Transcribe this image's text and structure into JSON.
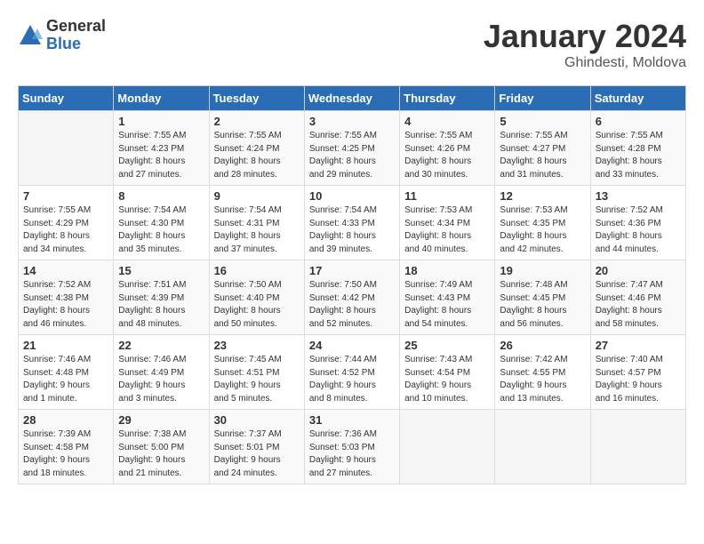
{
  "logo": {
    "general": "General",
    "blue": "Blue"
  },
  "title": "January 2024",
  "location": "Ghindesti, Moldova",
  "days_of_week": [
    "Sunday",
    "Monday",
    "Tuesday",
    "Wednesday",
    "Thursday",
    "Friday",
    "Saturday"
  ],
  "weeks": [
    [
      {
        "num": "",
        "detail": ""
      },
      {
        "num": "1",
        "detail": "Sunrise: 7:55 AM\nSunset: 4:23 PM\nDaylight: 8 hours\nand 27 minutes."
      },
      {
        "num": "2",
        "detail": "Sunrise: 7:55 AM\nSunset: 4:24 PM\nDaylight: 8 hours\nand 28 minutes."
      },
      {
        "num": "3",
        "detail": "Sunrise: 7:55 AM\nSunset: 4:25 PM\nDaylight: 8 hours\nand 29 minutes."
      },
      {
        "num": "4",
        "detail": "Sunrise: 7:55 AM\nSunset: 4:26 PM\nDaylight: 8 hours\nand 30 minutes."
      },
      {
        "num": "5",
        "detail": "Sunrise: 7:55 AM\nSunset: 4:27 PM\nDaylight: 8 hours\nand 31 minutes."
      },
      {
        "num": "6",
        "detail": "Sunrise: 7:55 AM\nSunset: 4:28 PM\nDaylight: 8 hours\nand 33 minutes."
      }
    ],
    [
      {
        "num": "7",
        "detail": "Sunrise: 7:55 AM\nSunset: 4:29 PM\nDaylight: 8 hours\nand 34 minutes."
      },
      {
        "num": "8",
        "detail": "Sunrise: 7:54 AM\nSunset: 4:30 PM\nDaylight: 8 hours\nand 35 minutes."
      },
      {
        "num": "9",
        "detail": "Sunrise: 7:54 AM\nSunset: 4:31 PM\nDaylight: 8 hours\nand 37 minutes."
      },
      {
        "num": "10",
        "detail": "Sunrise: 7:54 AM\nSunset: 4:33 PM\nDaylight: 8 hours\nand 39 minutes."
      },
      {
        "num": "11",
        "detail": "Sunrise: 7:53 AM\nSunset: 4:34 PM\nDaylight: 8 hours\nand 40 minutes."
      },
      {
        "num": "12",
        "detail": "Sunrise: 7:53 AM\nSunset: 4:35 PM\nDaylight: 8 hours\nand 42 minutes."
      },
      {
        "num": "13",
        "detail": "Sunrise: 7:52 AM\nSunset: 4:36 PM\nDaylight: 8 hours\nand 44 minutes."
      }
    ],
    [
      {
        "num": "14",
        "detail": "Sunrise: 7:52 AM\nSunset: 4:38 PM\nDaylight: 8 hours\nand 46 minutes."
      },
      {
        "num": "15",
        "detail": "Sunrise: 7:51 AM\nSunset: 4:39 PM\nDaylight: 8 hours\nand 48 minutes."
      },
      {
        "num": "16",
        "detail": "Sunrise: 7:50 AM\nSunset: 4:40 PM\nDaylight: 8 hours\nand 50 minutes."
      },
      {
        "num": "17",
        "detail": "Sunrise: 7:50 AM\nSunset: 4:42 PM\nDaylight: 8 hours\nand 52 minutes."
      },
      {
        "num": "18",
        "detail": "Sunrise: 7:49 AM\nSunset: 4:43 PM\nDaylight: 8 hours\nand 54 minutes."
      },
      {
        "num": "19",
        "detail": "Sunrise: 7:48 AM\nSunset: 4:45 PM\nDaylight: 8 hours\nand 56 minutes."
      },
      {
        "num": "20",
        "detail": "Sunrise: 7:47 AM\nSunset: 4:46 PM\nDaylight: 8 hours\nand 58 minutes."
      }
    ],
    [
      {
        "num": "21",
        "detail": "Sunrise: 7:46 AM\nSunset: 4:48 PM\nDaylight: 9 hours\nand 1 minute."
      },
      {
        "num": "22",
        "detail": "Sunrise: 7:46 AM\nSunset: 4:49 PM\nDaylight: 9 hours\nand 3 minutes."
      },
      {
        "num": "23",
        "detail": "Sunrise: 7:45 AM\nSunset: 4:51 PM\nDaylight: 9 hours\nand 5 minutes."
      },
      {
        "num": "24",
        "detail": "Sunrise: 7:44 AM\nSunset: 4:52 PM\nDaylight: 9 hours\nand 8 minutes."
      },
      {
        "num": "25",
        "detail": "Sunrise: 7:43 AM\nSunset: 4:54 PM\nDaylight: 9 hours\nand 10 minutes."
      },
      {
        "num": "26",
        "detail": "Sunrise: 7:42 AM\nSunset: 4:55 PM\nDaylight: 9 hours\nand 13 minutes."
      },
      {
        "num": "27",
        "detail": "Sunrise: 7:40 AM\nSunset: 4:57 PM\nDaylight: 9 hours\nand 16 minutes."
      }
    ],
    [
      {
        "num": "28",
        "detail": "Sunrise: 7:39 AM\nSunset: 4:58 PM\nDaylight: 9 hours\nand 18 minutes."
      },
      {
        "num": "29",
        "detail": "Sunrise: 7:38 AM\nSunset: 5:00 PM\nDaylight: 9 hours\nand 21 minutes."
      },
      {
        "num": "30",
        "detail": "Sunrise: 7:37 AM\nSunset: 5:01 PM\nDaylight: 9 hours\nand 24 minutes."
      },
      {
        "num": "31",
        "detail": "Sunrise: 7:36 AM\nSunset: 5:03 PM\nDaylight: 9 hours\nand 27 minutes."
      },
      {
        "num": "",
        "detail": ""
      },
      {
        "num": "",
        "detail": ""
      },
      {
        "num": "",
        "detail": ""
      }
    ]
  ]
}
